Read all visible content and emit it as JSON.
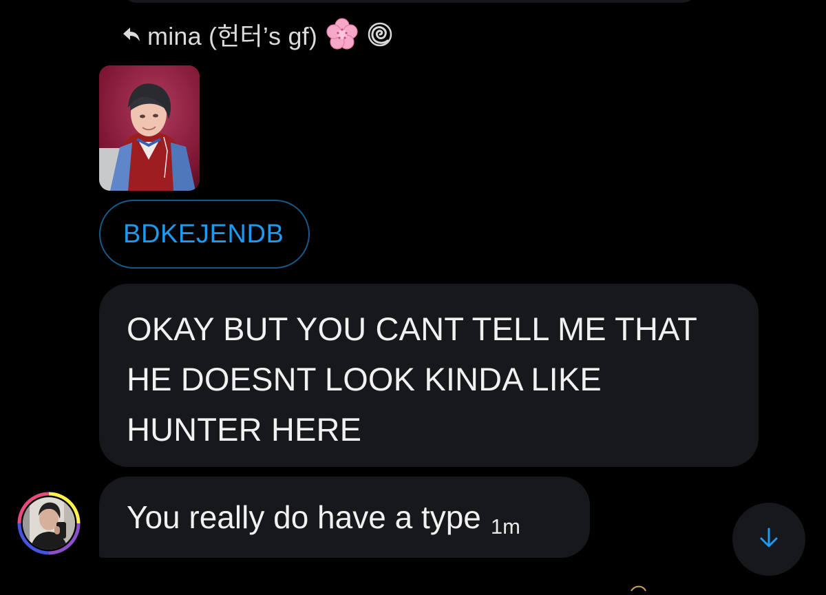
{
  "reply": {
    "label": "mina (헌터’s gf)"
  },
  "photo_message": {
    "image_name": "photo-attachment"
  },
  "link": {
    "text": "BDKEJENDB"
  },
  "messages": [
    {
      "lines": [
        "OKAY BUT YOU CANT TELL ME THAT",
        "HE DOESNT LOOK KINDA LIKE",
        "HUNTER HERE"
      ]
    },
    {
      "text": "You really do have a type",
      "time": "1m"
    }
  ],
  "icons": {
    "reply": "reply-arrow-icon",
    "flower": "cherry-blossom-icon",
    "spiral": "spiral-icon",
    "scroll": "arrow-down-icon"
  },
  "colors": {
    "background": "#000000",
    "bubble": "#16181c",
    "accent": "#1d9bf0"
  }
}
